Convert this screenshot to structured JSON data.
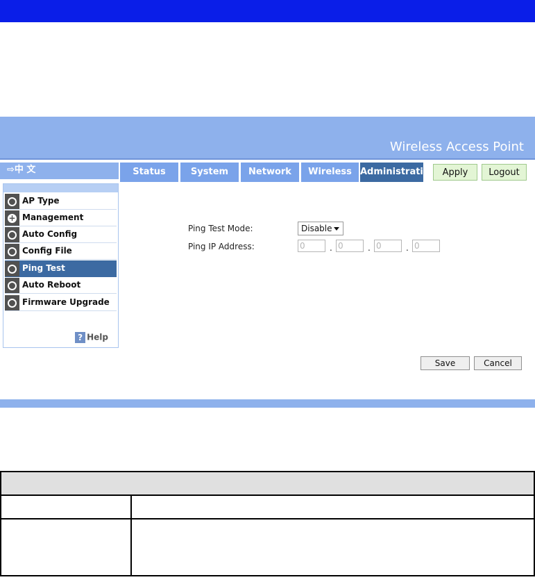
{
  "header": {
    "title": "Wireless Access Point"
  },
  "language": {
    "label": "⇨中 文"
  },
  "tabs": [
    {
      "label": "Status",
      "active": false
    },
    {
      "label": "System",
      "active": false
    },
    {
      "label": "Network",
      "active": false
    },
    {
      "label": "Wireless",
      "active": false
    },
    {
      "label": "Administration",
      "active": true
    }
  ],
  "toolbar": {
    "apply": "Apply",
    "logout": "Logout"
  },
  "sidebar": {
    "items": [
      {
        "label": "AP Type",
        "icon": "circle-icon",
        "active": false
      },
      {
        "label": "Management",
        "icon": "plus-icon",
        "active": false
      },
      {
        "label": "Auto Config",
        "icon": "circle-icon",
        "active": false
      },
      {
        "label": "Config File",
        "icon": "circle-icon",
        "active": false
      },
      {
        "label": "Ping Test",
        "icon": "circle-icon",
        "active": true
      },
      {
        "label": "Auto Reboot",
        "icon": "circle-icon",
        "active": false
      },
      {
        "label": "Firmware Upgrade",
        "icon": "circle-icon",
        "active": false
      }
    ],
    "help": "Help"
  },
  "form": {
    "ping_mode_label": "Ping Test Mode:",
    "ping_mode_value": "Disable",
    "ping_ip_label": "Ping IP Address:",
    "ip": [
      "0",
      "0",
      "0",
      "0"
    ],
    "separator": "."
  },
  "actions": {
    "save": "Save",
    "cancel": "Cancel"
  },
  "colors": {
    "header": "#8eb1ec",
    "active_tab": "#3c6aa2",
    "top_band": "#0a1ee8"
  }
}
